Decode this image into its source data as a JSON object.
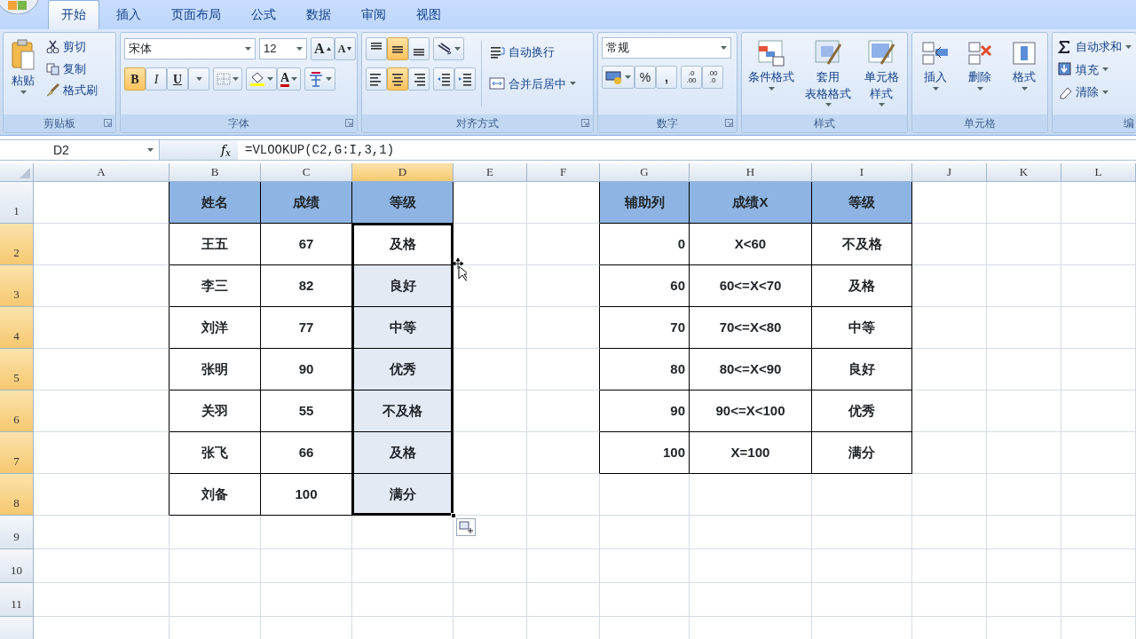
{
  "tabs": [
    {
      "label": "开始",
      "selected": true
    },
    {
      "label": "插入",
      "selected": false
    },
    {
      "label": "页面布局",
      "selected": false
    },
    {
      "label": "公式",
      "selected": false
    },
    {
      "label": "数据",
      "selected": false
    },
    {
      "label": "审阅",
      "selected": false
    },
    {
      "label": "视图",
      "selected": false
    }
  ],
  "ribbon": {
    "groups": [
      {
        "kind": "clipboard",
        "title": "剪贴板",
        "launcher": true,
        "paste": "粘贴",
        "items": [
          "剪切",
          "复制",
          "格式刷"
        ]
      },
      {
        "kind": "font",
        "title": "字体",
        "launcher": true,
        "font_name": "宋体",
        "font_size": "12",
        "grow": "A",
        "shrink": "A",
        "bold": {
          "label": "B",
          "on": true
        },
        "italic": {
          "label": "I",
          "on": false
        },
        "underline": {
          "label": "U",
          "on": false
        },
        "font_color": "A"
      },
      {
        "kind": "alignment",
        "title": "对齐方式",
        "launcher": true,
        "vertical": [
          {
            "selected": false
          },
          {
            "selected": true
          },
          {
            "selected": false
          }
        ],
        "horizontal": [
          {
            "selected": false
          },
          {
            "selected": true
          },
          {
            "selected": false
          }
        ],
        "wrap": "自动换行",
        "merge": "合并后居中"
      },
      {
        "kind": "number",
        "title": "数字",
        "launcher": true,
        "format": "常规",
        "percent": "%",
        "comma": ",",
        "decimals": [
          {
            "top": ".0",
            "bottom": ".00"
          },
          {
            "top": ".00",
            "bottom": ".0"
          }
        ]
      },
      {
        "kind": "styles",
        "title": "样式",
        "launcher": false,
        "buttons": [
          {
            "lines": [
              "条件格式"
            ]
          },
          {
            "lines": [
              "套用",
              "表格格式"
            ]
          },
          {
            "lines": [
              "单元格",
              "样式"
            ]
          }
        ]
      },
      {
        "kind": "cells",
        "title": "单元格",
        "launcher": false,
        "buttons": [
          {
            "lines": [
              "插入"
            ]
          },
          {
            "lines": [
              "删除"
            ]
          },
          {
            "lines": [
              "格式"
            ]
          }
        ]
      },
      {
        "kind": "editing",
        "title": "编",
        "launcher": false,
        "items": [
          "自动求和",
          "填充",
          "清除"
        ]
      }
    ]
  },
  "formula_bar": {
    "name_box": "D2",
    "fx": "f$_{x}$",
    "formula": "=VLOOKUP(C2,G:I,3,1)"
  },
  "sheet": {
    "columns": [
      {
        "label": "A",
        "selected": false
      },
      {
        "label": "B",
        "selected": false
      },
      {
        "label": "C",
        "selected": false
      },
      {
        "label": "D",
        "selected": true
      },
      {
        "label": "E",
        "selected": false
      },
      {
        "label": "F",
        "selected": false
      },
      {
        "label": "G",
        "selected": false
      },
      {
        "label": "H",
        "selected": false
      },
      {
        "label": "I",
        "selected": false
      },
      {
        "label": "J",
        "selected": false
      },
      {
        "label": "K",
        "selected": false
      },
      {
        "label": "L",
        "selected": false
      }
    ],
    "row_labels": [
      "1",
      "2",
      "3",
      "4",
      "5",
      "6",
      "7",
      "8",
      "9",
      "10",
      "11"
    ],
    "score_table": {
      "header": [
        "姓名",
        "成绩",
        "等级"
      ],
      "rows": [
        {
          "cells": [
            "王五",
            "67",
            "及格"
          ],
          "selected": true,
          "active": true
        },
        {
          "cells": [
            "李三",
            "82",
            "良好"
          ],
          "selected": true,
          "active": false
        },
        {
          "cells": [
            "刘洋",
            "77",
            "中等"
          ],
          "selected": true,
          "active": false
        },
        {
          "cells": [
            "张明",
            "90",
            "优秀"
          ],
          "selected": true,
          "active": false
        },
        {
          "cells": [
            "关羽",
            "55",
            "不及格"
          ],
          "selected": true,
          "active": false
        },
        {
          "cells": [
            "张飞",
            "66",
            "及格"
          ],
          "selected": true,
          "active": false
        },
        {
          "cells": [
            "刘备",
            "100",
            "满分"
          ],
          "selected": true,
          "active": false
        }
      ]
    },
    "lookup_table": {
      "header": [
        "辅助列",
        "成绩X",
        "等级"
      ],
      "rows": [
        [
          "0",
          "X<60",
          "不及格"
        ],
        [
          "60",
          "60<=X<70",
          "及格"
        ],
        [
          "70",
          "70<=X<80",
          "中等"
        ],
        [
          "80",
          "80<=X<90",
          "良好"
        ],
        [
          "90",
          "90<=X<100",
          "优秀"
        ],
        [
          "100",
          "X=100",
          "满分"
        ]
      ]
    }
  }
}
